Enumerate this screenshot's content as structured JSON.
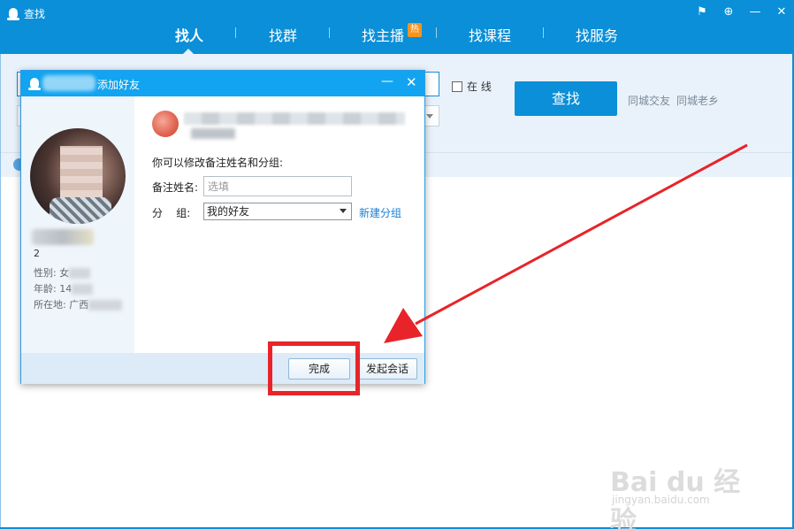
{
  "main_window": {
    "title": "查找",
    "controls": {
      "feedback": "⚑",
      "pin": "⊕",
      "minimize": "—",
      "close": "✕"
    },
    "tabs": [
      "找人",
      "找群",
      "找主播",
      "找课程",
      "找服务"
    ],
    "hot_badge": "热",
    "online_label": "在 线",
    "search_button": "查找",
    "city_links": [
      "同城交友",
      "同城老乡"
    ]
  },
  "dialog": {
    "title": "添加好友",
    "minimize": "—",
    "close": "✕",
    "profile": {
      "number_partial": "2",
      "gender_label": "性别:",
      "gender_value": "女",
      "age_label": "年龄:",
      "age_value": "14",
      "location_label": "所在地:",
      "location_value": "广西"
    },
    "prompt": "你可以修改备注姓名和分组:",
    "remark_label": "备注姓名:",
    "remark_placeholder": "选填",
    "group_label": "分    组:",
    "group_value": "我的好友",
    "new_group_link": "新建分组",
    "done_button": "完成",
    "chat_button": "发起会话"
  },
  "watermark": {
    "brand": "Bai du 经验",
    "url": "jingyan.baidu.com"
  },
  "colors": {
    "accent": "#0a8fd8",
    "dialog_title": "#12a4f0",
    "highlight": "#e8242a",
    "link": "#1a7fd4"
  }
}
